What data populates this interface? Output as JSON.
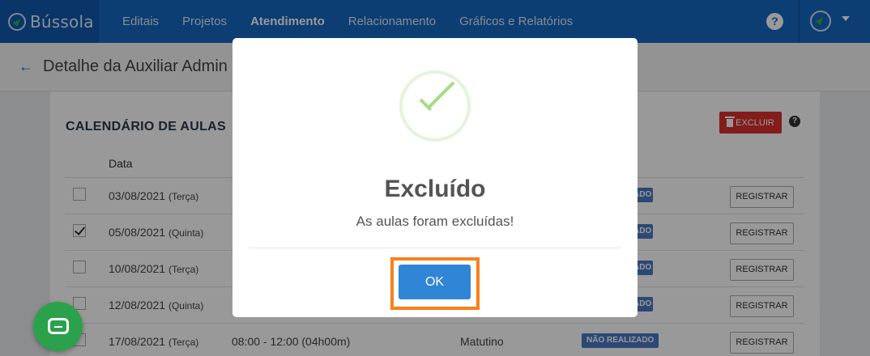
{
  "nav": {
    "brand": "Bússola",
    "links": [
      "Editais",
      "Projetos",
      "Atendimento",
      "Relacionamento",
      "Gráficos e Relatórios"
    ],
    "active_link": "Atendimento",
    "help": "?"
  },
  "subheader": {
    "back_icon": "←",
    "title": "Detalhe da Auxiliar Admin"
  },
  "card": {
    "title": "CALENDÁRIO DE AULAS",
    "excluir_label": "EXCLUIR",
    "help": "?",
    "column_data": "Data",
    "rows": [
      {
        "date": "03/08/2021",
        "day": "(Terça)",
        "time": "",
        "turno": "",
        "badge": "ADO",
        "checked": false,
        "action": "REGISTRAR"
      },
      {
        "date": "05/08/2021",
        "day": "(Quinta)",
        "time": "",
        "turno": "",
        "badge": "ADO",
        "checked": true,
        "action": "REGISTRAR"
      },
      {
        "date": "10/08/2021",
        "day": "(Terça)",
        "time": "",
        "turno": "",
        "badge": "ADO",
        "checked": false,
        "action": "REGISTRAR"
      },
      {
        "date": "12/08/2021",
        "day": "(Quinta)",
        "time": "",
        "turno": "",
        "badge": "ADO",
        "checked": false,
        "action": "REGISTRAR"
      },
      {
        "date": "17/08/2021",
        "day": "(Terça)",
        "time": "08:00 - 12:00 (04h00m)",
        "turno": "Matutino",
        "badge": "NÃO REALIZADO",
        "checked": false,
        "action": "REGISTRAR"
      }
    ]
  },
  "modal": {
    "title": "Excluído",
    "message": "As aulas foram excluídas!",
    "ok_label": "OK",
    "icon": "success-check-icon"
  },
  "colors": {
    "nav_bg": "#1566c0",
    "danger": "#d9312e",
    "primary": "#3085d6",
    "success": "#a5dc86",
    "highlight": "#f7811f",
    "chat": "#2aa14a"
  }
}
